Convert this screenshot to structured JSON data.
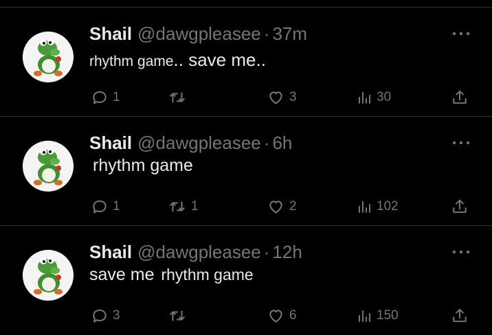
{
  "tweets": [
    {
      "name": "Shail",
      "handle": "@dawgpleasee",
      "separator": "·",
      "time": "37m",
      "text_parts": [
        "rhythm game",
        ".. save me.."
      ],
      "replies": "1",
      "reposts": "",
      "likes": "3",
      "views": "30"
    },
    {
      "name": "Shail",
      "handle": "@dawgpleasee",
      "separator": "·",
      "time": "6h",
      "text_parts": [
        "rhythm game"
      ],
      "replies": "1",
      "reposts": "1",
      "likes": "2",
      "views": "102"
    },
    {
      "name": "Shail",
      "handle": "@dawgpleasee",
      "separator": "·",
      "time": "12h",
      "text_parts": [
        "save me",
        "rhythm game"
      ],
      "replies": "3",
      "reposts": "",
      "likes": "6",
      "views": "150"
    }
  ],
  "icons": {
    "avatar": "yoshi-avatar",
    "reply": "reply-icon",
    "repost": "repost-icon",
    "like": "like-icon",
    "views": "views-icon",
    "share": "share-icon",
    "more": "more-icon"
  },
  "colors": {
    "background": "#000000",
    "text": "#e7e9ea",
    "muted": "#71767b",
    "divider": "#2f3336"
  }
}
